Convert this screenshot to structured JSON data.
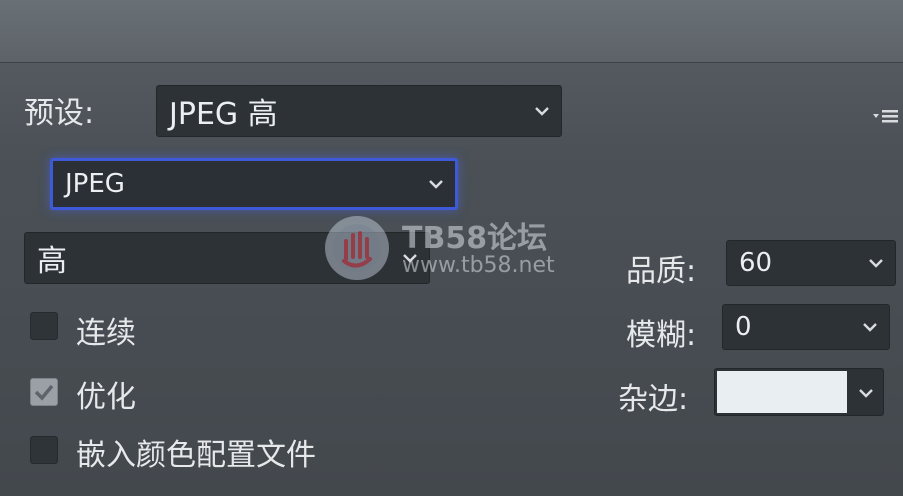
{
  "preset": {
    "label": "预设:",
    "value": "JPEG 高"
  },
  "format": {
    "value": "JPEG"
  },
  "quality_preset": {
    "value": "高"
  },
  "options": {
    "progressive": {
      "label": "连续",
      "checked": false
    },
    "optimized": {
      "label": "优化",
      "checked": true
    },
    "embed_profile": {
      "label": "嵌入颜色配置文件",
      "checked": false
    }
  },
  "quality": {
    "label": "品质:",
    "value": "60"
  },
  "blur": {
    "label": "模糊:",
    "value": "0"
  },
  "matte": {
    "label": "杂边:",
    "color": "#e9eef2"
  },
  "watermark": {
    "title": "TB58论坛",
    "url": "www.tb58.net"
  },
  "icons": {
    "menu": "panel-menu-icon",
    "chevron": "chevron-down-icon",
    "check": "checkmark-icon"
  },
  "colors": {
    "focus": "#3f5ad8",
    "background": "#4b5157",
    "field": "#2d3236"
  }
}
